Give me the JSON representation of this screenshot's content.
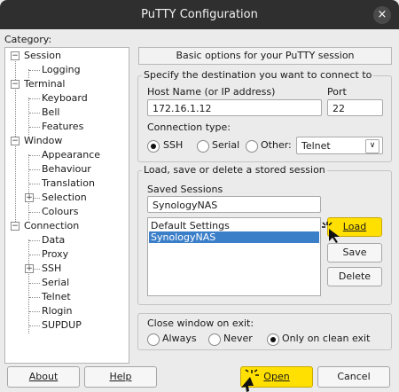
{
  "window": {
    "title": "PuTTY Configuration",
    "close_icon": "×"
  },
  "category": {
    "label": "Category:",
    "tree": {
      "session": "Session",
      "logging": "Logging",
      "terminal": "Terminal",
      "keyboard": "Keyboard",
      "bell": "Bell",
      "features": "Features",
      "window": "Window",
      "appearance": "Appearance",
      "behaviour": "Behaviour",
      "translation": "Translation",
      "selection": "Selection",
      "colours": "Colours",
      "connection": "Connection",
      "data": "Data",
      "proxy": "Proxy",
      "ssh": "SSH",
      "serial": "Serial",
      "telnet": "Telnet",
      "rlogin": "Rlogin",
      "supdup": "SUPDUP"
    }
  },
  "panel": {
    "header": "Basic options for your PuTTY session",
    "destination": {
      "legend": "Specify the destination you want to connect to",
      "host_label": "Host Name (or IP address)",
      "host_value": "172.16.1.12",
      "port_label": "Port",
      "port_value": "22",
      "conn_type_label": "Connection type:",
      "ssh": "SSH",
      "serial": "Serial",
      "other": "Other:",
      "other_value": "Telnet",
      "selected": "SSH"
    },
    "sessions": {
      "legend": "Load, save or delete a stored session",
      "saved_label": "Saved Sessions",
      "saved_value": "SynologyNAS",
      "items": [
        "Default Settings",
        "SynologyNAS"
      ],
      "selected_item": "SynologyNAS",
      "load": "Load",
      "save": "Save",
      "delete": "Delete"
    },
    "close_on_exit": {
      "legend": "Close window on exit:",
      "always": "Always",
      "never": "Never",
      "clean": "Only on clean exit",
      "selected": "Only on clean exit"
    }
  },
  "footer": {
    "about": "About",
    "help": "Help",
    "open": "Open",
    "cancel": "Cancel"
  },
  "colors": {
    "highlight": "#ffe000",
    "selection": "#3c7fc9",
    "titlebar": "#2f2f2f"
  }
}
